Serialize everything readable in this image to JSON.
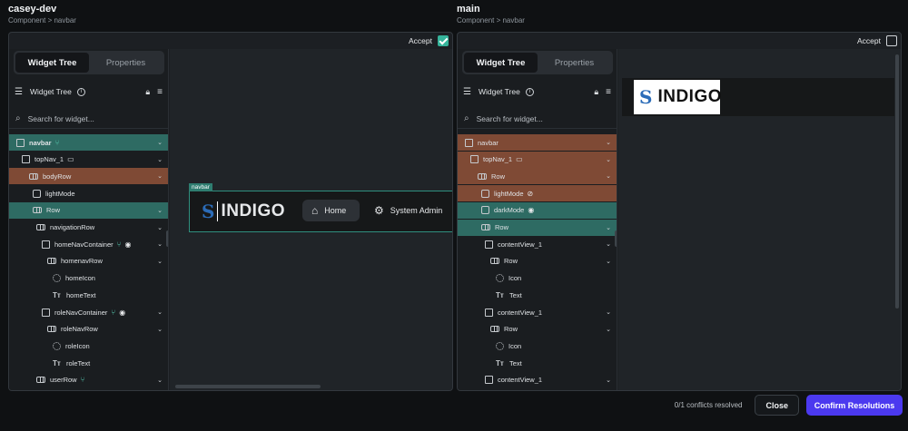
{
  "left": {
    "title": "casey-dev",
    "breadcrumb": "Component > navbar",
    "accept_label": "Accept",
    "accept_checked": true,
    "tabs": [
      "Widget Tree",
      "Properties"
    ],
    "tree_header": "Widget Tree",
    "search_placeholder": "Search for widget...",
    "rows": [
      {
        "label": "navbar",
        "icon": "checkbox",
        "badge": "branch-icon",
        "hl": "teal",
        "caret": "⌄",
        "bold": true
      },
      {
        "label": "topNav_1",
        "icon": "checkbox",
        "badge": "device-icon",
        "caret": "⌄"
      },
      {
        "label": "bodyRow",
        "icon": "row",
        "hl": "brown",
        "caret": "⌄"
      },
      {
        "label": "lightMode",
        "icon": "image"
      },
      {
        "label": "Row",
        "icon": "row",
        "hl": "teal",
        "caret": "⌄"
      },
      {
        "label": "navigationRow",
        "icon": "row",
        "caret": "⌄"
      },
      {
        "label": "homeNavContainer",
        "icon": "checkbox",
        "badge": "branch-icon",
        "eye": true,
        "caret": "⌄"
      },
      {
        "label": "homenavRow",
        "icon": "row",
        "caret": "⌄"
      },
      {
        "label": "homeIcon",
        "icon": "gear"
      },
      {
        "label": "homeText",
        "icon": "text"
      },
      {
        "label": "roleNavContainer",
        "icon": "checkbox",
        "badge": "branch-icon",
        "eye": true,
        "caret": "⌄"
      },
      {
        "label": "roleNavRow",
        "icon": "row",
        "caret": "⌄"
      },
      {
        "label": "roleIcon",
        "icon": "gear"
      },
      {
        "label": "roleText",
        "icon": "text"
      },
      {
        "label": "userRow",
        "icon": "row",
        "badge": "branch-icon",
        "caret": "⌄"
      }
    ],
    "preview": {
      "tag": "navbar",
      "logo_text": "INDIGO",
      "nav_home": "Home",
      "nav_admin": "System Admin"
    }
  },
  "right": {
    "title": "main",
    "breadcrumb": "Component > navbar",
    "accept_label": "Accept",
    "accept_checked": false,
    "tabs": [
      "Widget Tree",
      "Properties"
    ],
    "tree_header": "Widget Tree",
    "search_placeholder": "Search for widget...",
    "rows": [
      {
        "label": "navbar",
        "icon": "checkbox",
        "hl": "brown",
        "caret": "⌄"
      },
      {
        "label": "topNav_1",
        "icon": "checkbox",
        "badge": "device-icon",
        "hl": "brown",
        "caret": "⌄"
      },
      {
        "label": "Row",
        "icon": "row",
        "hl": "brown",
        "caret": "⌄"
      },
      {
        "label": "lightMode",
        "icon": "image",
        "eyeoff": true,
        "hl": "brown"
      },
      {
        "label": "darkMode",
        "icon": "image",
        "eye": true,
        "hl": "teal"
      },
      {
        "label": "Row",
        "icon": "row",
        "hl": "teal",
        "caret": "⌄"
      },
      {
        "label": "contentView_1",
        "icon": "checkbox",
        "caret": "⌄"
      },
      {
        "label": "Row",
        "icon": "row",
        "caret": "⌄"
      },
      {
        "label": "Icon",
        "icon": "gear"
      },
      {
        "label": "Text",
        "icon": "text"
      },
      {
        "label": "contentView_1",
        "icon": "checkbox",
        "caret": "⌄"
      },
      {
        "label": "Row",
        "icon": "row",
        "caret": "⌄"
      },
      {
        "label": "Icon",
        "icon": "gear"
      },
      {
        "label": "Text",
        "icon": "text"
      },
      {
        "label": "contentView_1",
        "icon": "checkbox",
        "caret": "⌄"
      }
    ],
    "preview": {
      "logo_text": "INDIGO"
    }
  },
  "footer": {
    "status": "0/1 conflicts resolved",
    "close_label": "Close",
    "confirm_label": "Confirm Resolutions"
  },
  "colors": {
    "teal_highlight": "#2e6b63",
    "brown_highlight": "#7f4a35",
    "accent": "#4b39ef",
    "accept_check": "#35b39a"
  }
}
